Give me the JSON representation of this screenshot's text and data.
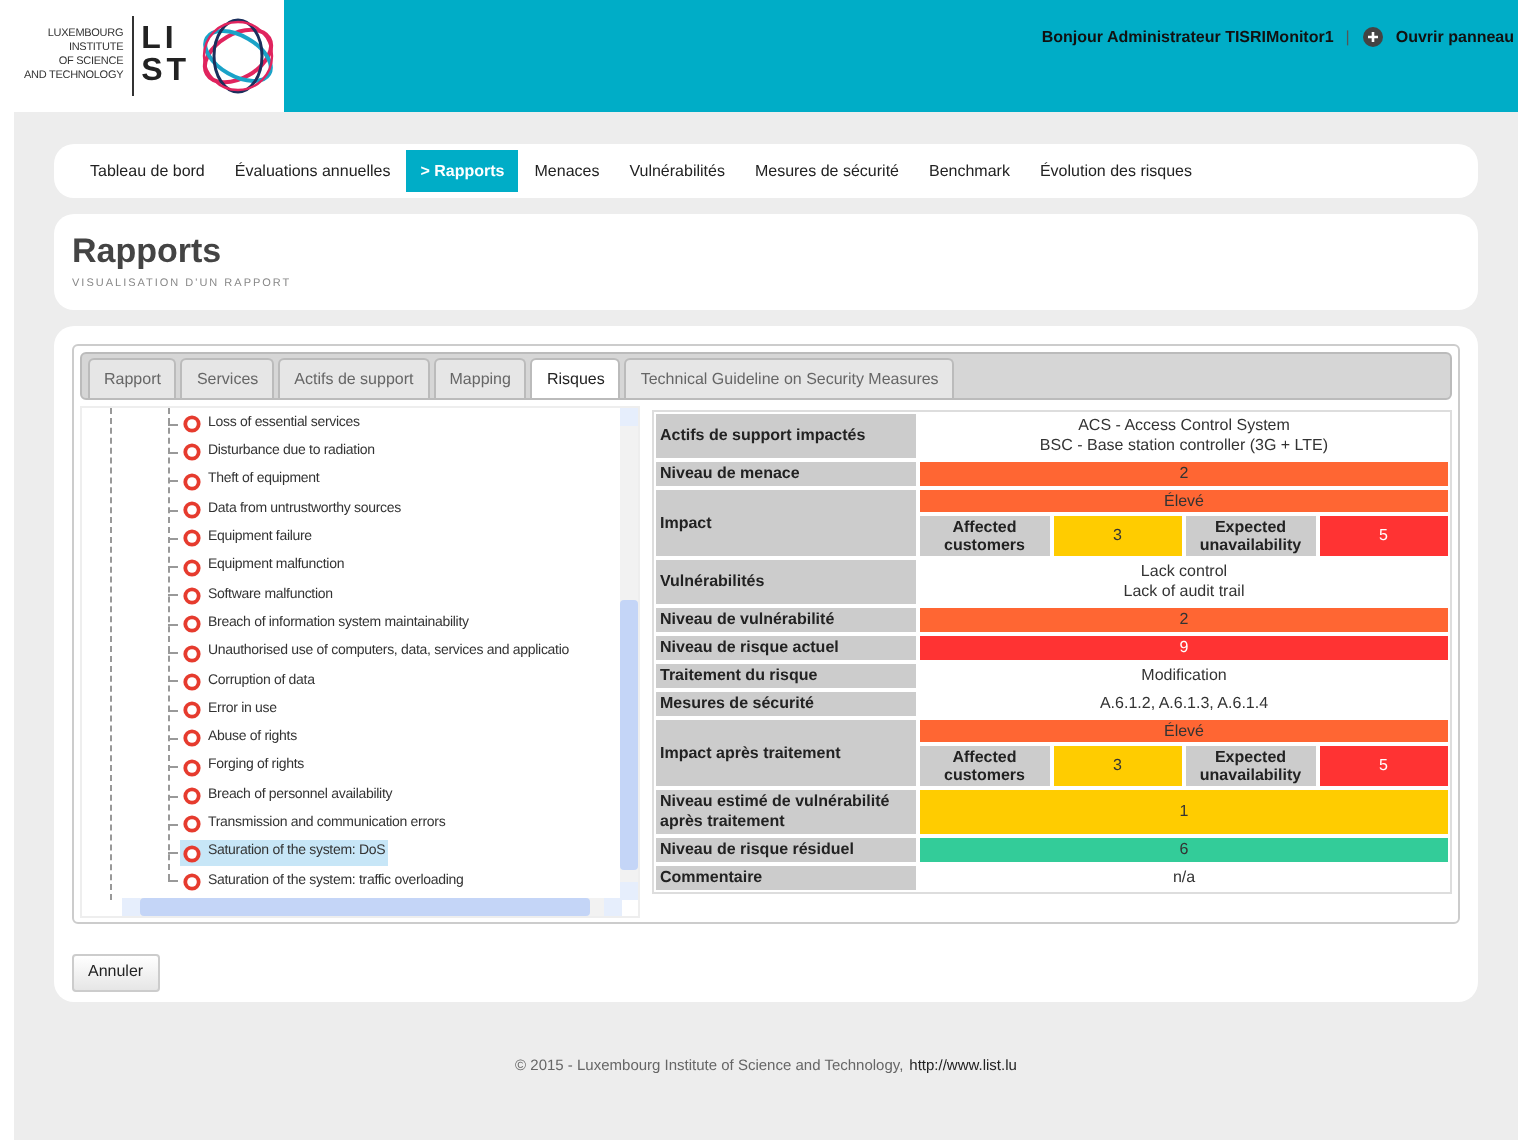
{
  "logo": {
    "name_lines": [
      "LUXEMBOURG",
      "INSTITUTE",
      "OF SCIENCE",
      "AND TECHNOLOGY"
    ],
    "mark_lines": [
      "LI",
      "ST"
    ]
  },
  "user_bar": {
    "greeting": "Bonjour Administrateur TISRIMonitor1",
    "separator": "|",
    "panel_link": "Ouvrir panneau"
  },
  "nav": [
    {
      "label": "Tableau de bord",
      "selected": false
    },
    {
      "label": "Évaluations annuelles",
      "selected": false
    },
    {
      "label": "> Rapports",
      "selected": true
    },
    {
      "label": "Menaces",
      "selected": false
    },
    {
      "label": "Vulnérabilités",
      "selected": false
    },
    {
      "label": "Mesures de sécurité",
      "selected": false
    },
    {
      "label": "Benchmark",
      "selected": false
    },
    {
      "label": "Évolution des risques",
      "selected": false
    }
  ],
  "page": {
    "title": "Rapports",
    "subtitle": "VISUALISATION D'UN RAPPORT"
  },
  "tabs": [
    {
      "label": "Rapport",
      "selected": false
    },
    {
      "label": "Services",
      "selected": false
    },
    {
      "label": "Actifs de support",
      "selected": false
    },
    {
      "label": "Mapping",
      "selected": false
    },
    {
      "label": "Risques",
      "selected": true
    },
    {
      "label": "Technical Guideline on Security Measures",
      "selected": false
    }
  ],
  "tree": [
    {
      "label": "Loss of essential services",
      "selected": false
    },
    {
      "label": "Disturbance due to radiation",
      "selected": false
    },
    {
      "label": "Theft of equipment",
      "selected": false
    },
    {
      "label": "Data from untrustworthy sources",
      "selected": false
    },
    {
      "label": "Equipment failure",
      "selected": false
    },
    {
      "label": "Equipment malfunction",
      "selected": false
    },
    {
      "label": "Software malfunction",
      "selected": false
    },
    {
      "label": "Breach of information system maintainability",
      "selected": false
    },
    {
      "label": "Unauthorised use of computers, data, services and applicatio",
      "selected": false
    },
    {
      "label": "Corruption of data",
      "selected": false
    },
    {
      "label": "Error in use",
      "selected": false
    },
    {
      "label": "Abuse of rights",
      "selected": false
    },
    {
      "label": "Forging of rights",
      "selected": false
    },
    {
      "label": "Breach of personnel availability",
      "selected": false
    },
    {
      "label": "Transmission and communication errors",
      "selected": false
    },
    {
      "label": "Saturation of the system: DoS",
      "selected": true
    },
    {
      "label": "Saturation of the system: traffic overloading",
      "selected": false
    }
  ],
  "risk_table": [
    {
      "kind": "text",
      "label": "Actifs de support impactés",
      "lines": [
        "ACS - Access Control System",
        "BSC - Base station controller (3G + LTE)"
      ]
    },
    {
      "kind": "level",
      "label": "Niveau de menace",
      "value": "2",
      "color": "#ff6633"
    },
    {
      "kind": "impact",
      "label": "Impact",
      "value": "Élevé",
      "color": "#ff6633",
      "parts": [
        {
          "label": "Affected customers",
          "value": "3",
          "color": "#ffcc00"
        },
        {
          "label": "Expected unavailability",
          "value": "5",
          "color": "#ff3333"
        }
      ]
    },
    {
      "kind": "text",
      "label": "Vulnérabilités",
      "lines": [
        "Lack control",
        "Lack of audit trail"
      ]
    },
    {
      "kind": "level",
      "label": "Niveau de vulnérabilité",
      "value": "2",
      "color": "#ff6633"
    },
    {
      "kind": "level",
      "label": "Niveau de risque actuel",
      "value": "9",
      "color": "#ff3333"
    },
    {
      "kind": "text",
      "label": "Traitement du risque",
      "lines": [
        "Modification"
      ]
    },
    {
      "kind": "text",
      "label": "Mesures de sécurité",
      "lines": [
        "A.6.1.2, A.6.1.3, A.6.1.4"
      ]
    },
    {
      "kind": "impact",
      "label": "Impact après traitement",
      "value": "Élevé",
      "color": "#ff6633",
      "parts": [
        {
          "label": "Affected customers",
          "value": "3",
          "color": "#ffcc00"
        },
        {
          "label": "Expected unavailability",
          "value": "5",
          "color": "#ff3333"
        }
      ]
    },
    {
      "kind": "level",
      "label": "Niveau estimé de vulnérabilité après traitement",
      "value": "1",
      "color": "#ffcc00"
    },
    {
      "kind": "level",
      "label": "Niveau de risque résiduel",
      "value": "6",
      "color": "#33cc99"
    },
    {
      "kind": "text",
      "label": "Commentaire",
      "lines": [
        "n/a"
      ]
    }
  ],
  "cancel_button": "Annuler",
  "footer": {
    "text": "© 2015 - Luxembourg Institute of Science and Technology,",
    "link": "http://www.list.lu"
  }
}
